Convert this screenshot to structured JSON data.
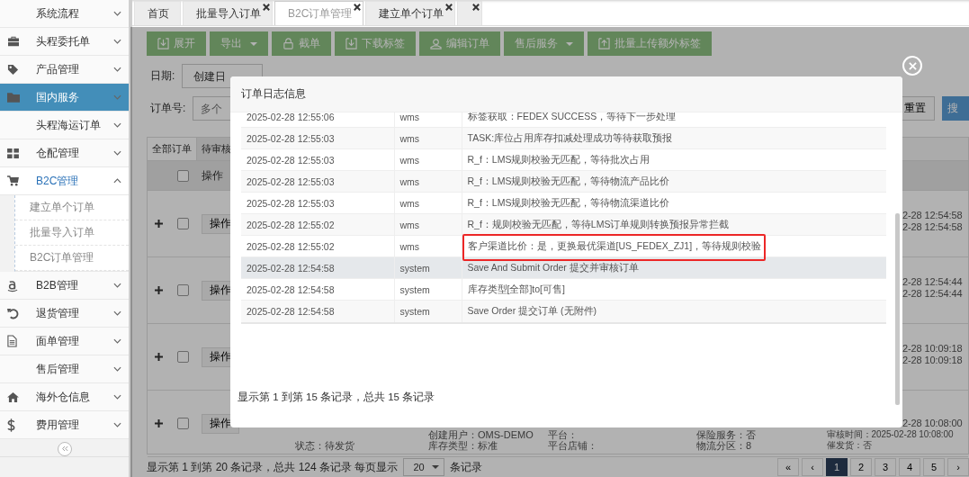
{
  "sidebar": {
    "items": [
      {
        "label": "系统流程",
        "kind": "none",
        "selected": false,
        "expanded": false
      },
      {
        "label": "头程委托单",
        "kind": "briefcase",
        "selected": false,
        "expanded": false
      },
      {
        "label": "产品管理",
        "kind": "tag",
        "selected": false,
        "expanded": false
      },
      {
        "label": "国内服务",
        "kind": "folder",
        "selected": true,
        "expanded": false
      },
      {
        "label": "头程海运订单",
        "kind": "none",
        "selected": false,
        "expanded": false
      },
      {
        "label": "仓配管理",
        "kind": "grid",
        "selected": false,
        "expanded": false
      },
      {
        "label": "B2C管理",
        "kind": "cart",
        "selected": false,
        "expanded": true,
        "children": [
          {
            "label": "建立单个订单"
          },
          {
            "label": "批量导入订单"
          },
          {
            "label": "B2C订单管理"
          }
        ]
      },
      {
        "label": "B2B管理",
        "kind": "smile",
        "selected": false,
        "expanded": false
      },
      {
        "label": "退货管理",
        "kind": "undo",
        "selected": false,
        "expanded": false
      },
      {
        "label": "面单管理",
        "kind": "doc",
        "selected": false,
        "expanded": false
      },
      {
        "label": "售后管理",
        "kind": "none",
        "selected": false,
        "expanded": false
      },
      {
        "label": "海外仓信息",
        "kind": "home",
        "selected": false,
        "expanded": false
      },
      {
        "label": "费用管理",
        "kind": "dollar",
        "selected": false,
        "expanded": false
      }
    ]
  },
  "tabs": [
    {
      "label": "首页",
      "closable": false,
      "selected": false
    },
    {
      "label": "批量导入订单",
      "closable": true,
      "selected": false
    },
    {
      "label": "B2C订单管理",
      "closable": true,
      "selected": true
    },
    {
      "label": "建立单个订单",
      "closable": true,
      "selected": false
    },
    {
      "closable": true,
      "selected": false
    }
  ],
  "toolbar": [
    {
      "label": "展开",
      "kind": "download",
      "dropdown": false
    },
    {
      "label": "导出",
      "kind": "none",
      "dropdown": true
    },
    {
      "label": "截单",
      "kind": "lock",
      "dropdown": false
    },
    {
      "label": "下载标签",
      "kind": "download",
      "dropdown": false
    },
    {
      "label": "编辑订单",
      "kind": "user",
      "dropdown": false
    },
    {
      "label": "售后服务",
      "kind": "none",
      "dropdown": true
    },
    {
      "label": "批量上传额外标签",
      "kind": "upload",
      "dropdown": false
    }
  ],
  "filters": {
    "date_label": "日期:",
    "date_select": "创建日",
    "order_label": "订单号:",
    "order_placeholder": "多个",
    "reset": "重置",
    "search": "搜"
  },
  "orders": {
    "tabs": [
      {
        "label": "全部订单",
        "selected": true
      },
      {
        "label": "待审核",
        "selected": false
      }
    ],
    "header": "操作",
    "all_checked": false,
    "rows": [
      {
        "checked": false,
        "action": "操作",
        "times": [
          "2-28 12:54:58",
          "2-28 12:54:58"
        ]
      },
      {
        "checked": false,
        "action": "操作",
        "times": [
          "2-28 12:54:44",
          "2-28 12:54:44"
        ]
      },
      {
        "checked": false,
        "action": "操作",
        "times": [
          "2-28 10:09:18",
          "2-28 10:09:18"
        ]
      },
      {
        "checked": false,
        "action": "操作",
        "times": [
          "2-28 10:08:00"
        ],
        "details": [
          [
            "状态：待发货"
          ],
          [
            "创建用户：OMS-DEMO",
            "库存类型：标准"
          ],
          [
            "平台：",
            "平台店铺："
          ],
          [
            "保险服务：否",
            "物流分区：8"
          ],
          [
            "审核时间：2025-02-28 10:08:00",
            "催发货：否"
          ]
        ]
      }
    ]
  },
  "pagination": {
    "summary": "显示第 1 到第 20 条记录，总共 124 条记录 每页显示",
    "page_size": "20",
    "suffix": "条记录",
    "pages": [
      {
        "label": "«",
        "selected": false
      },
      {
        "label": "‹",
        "selected": false
      },
      {
        "label": "1",
        "selected": true
      },
      {
        "label": "2",
        "selected": false
      },
      {
        "label": "3",
        "selected": false
      },
      {
        "label": "4",
        "selected": false
      },
      {
        "label": "5",
        "selected": false
      },
      {
        "label": "›",
        "selected": false
      }
    ]
  },
  "modal": {
    "title": "订单日志信息",
    "rows": [
      {
        "time": "2025-02-28 12:55:06",
        "operator": "wms",
        "message": "标签获取：FEDEX SUCCESS，等待下一步处理",
        "highlighted": false,
        "marked": false
      },
      {
        "time": "2025-02-28 12:55:03",
        "operator": "wms",
        "message": "TASK:库位占用库存扣减处理成功等待获取预报",
        "highlighted": false,
        "marked": false
      },
      {
        "time": "2025-02-28 12:55:03",
        "operator": "wms",
        "message": "R_f：LMS规则校验无匹配，等待批次占用",
        "highlighted": false,
        "marked": false
      },
      {
        "time": "2025-02-28 12:55:03",
        "operator": "wms",
        "message": "R_f：LMS规则校验无匹配，等待物流产品比价",
        "highlighted": false,
        "marked": false
      },
      {
        "time": "2025-02-28 12:55:03",
        "operator": "wms",
        "message": "R_f：LMS规则校验无匹配，等待物流渠道比价",
        "highlighted": false,
        "marked": false
      },
      {
        "time": "2025-02-28 12:55:02",
        "operator": "wms",
        "message": "R_f：规则校验无匹配，等待LMS订单规则转换预报异常拦截",
        "highlighted": false,
        "marked": false
      },
      {
        "time": "2025-02-28 12:55:02",
        "operator": "wms",
        "message": "客户渠道比价：是，更换最优渠道[US_FEDEX_ZJ1]，等待规则校验",
        "highlighted": false,
        "marked": true
      },
      {
        "time": "2025-02-28 12:54:58",
        "operator": "system",
        "message": "Save And Submit Order 提交并审核订单",
        "highlighted": true,
        "marked": false
      },
      {
        "time": "2025-02-28 12:54:58",
        "operator": "system",
        "message": "库存类型[全部]to[可售]",
        "highlighted": false,
        "marked": false
      },
      {
        "time": "2025-02-28 12:54:58",
        "operator": "system",
        "message": "Save Order 提交订单 (无附件)",
        "highlighted": false,
        "marked": false
      }
    ],
    "footer": "显示第 1 到第 15 条记录，总共 15 条记录"
  }
}
